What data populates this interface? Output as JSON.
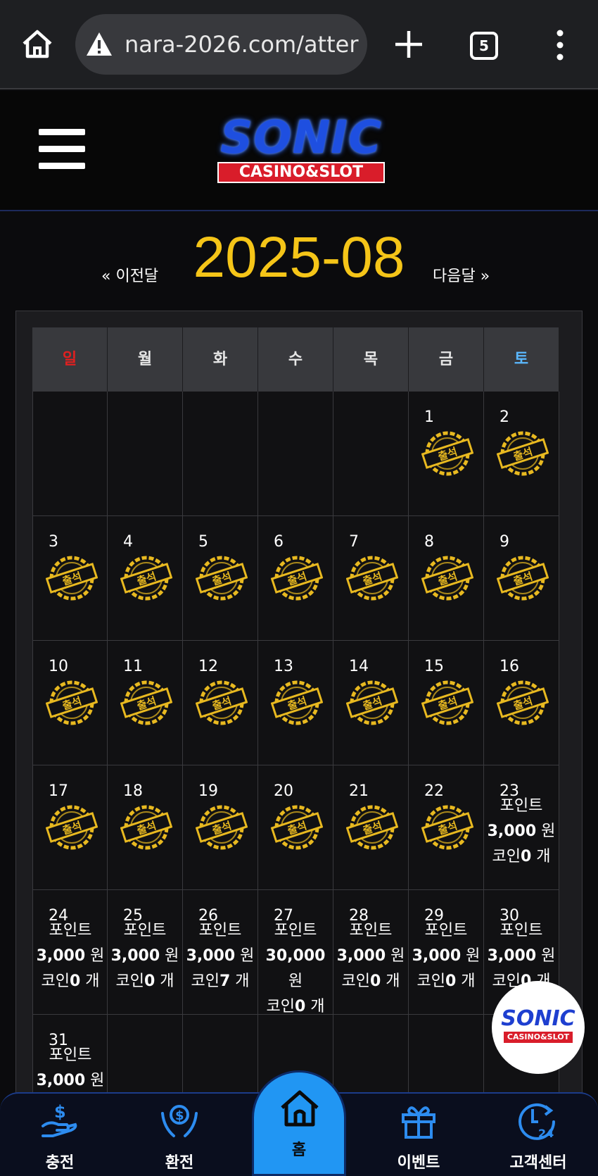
{
  "browser": {
    "url": "nara-2026.com/atter",
    "tab_count": "5"
  },
  "site": {
    "logo_main": "SONIC",
    "logo_sub": "CASINO&SLOT"
  },
  "calendar": {
    "prev_label": "« 이전달",
    "month": "2025-08",
    "next_label": "다음달 »",
    "weekdays": [
      "일",
      "월",
      "화",
      "수",
      "목",
      "금",
      "토"
    ],
    "stamp_label": "출석",
    "weeks": [
      [
        {
          "day": ""
        },
        {
          "day": ""
        },
        {
          "day": ""
        },
        {
          "day": ""
        },
        {
          "day": ""
        },
        {
          "day": "1",
          "stamp": true
        },
        {
          "day": "2",
          "stamp": true
        }
      ],
      [
        {
          "day": "3",
          "stamp": true
        },
        {
          "day": "4",
          "stamp": true
        },
        {
          "day": "5",
          "stamp": true
        },
        {
          "day": "6",
          "stamp": true
        },
        {
          "day": "7",
          "stamp": true
        },
        {
          "day": "8",
          "stamp": true
        },
        {
          "day": "9",
          "stamp": true
        }
      ],
      [
        {
          "day": "10",
          "stamp": true
        },
        {
          "day": "11",
          "stamp": true
        },
        {
          "day": "12",
          "stamp": true
        },
        {
          "day": "13",
          "stamp": true
        },
        {
          "day": "14",
          "stamp": true
        },
        {
          "day": "15",
          "stamp": true
        },
        {
          "day": "16",
          "stamp": true
        }
      ],
      [
        {
          "day": "17",
          "stamp": true
        },
        {
          "day": "18",
          "stamp": true
        },
        {
          "day": "19",
          "stamp": true
        },
        {
          "day": "20",
          "stamp": true
        },
        {
          "day": "21",
          "stamp": true
        },
        {
          "day": "22",
          "stamp": true
        },
        {
          "day": "23",
          "point_label": "포인트",
          "points": "3,000",
          "point_unit": "원",
          "coin_label": "코인",
          "coins": "0",
          "coin_unit": "개"
        }
      ],
      [
        {
          "day": "24",
          "point_label": "포인트",
          "points": "3,000",
          "point_unit": "원",
          "coin_label": "코인",
          "coins": "0",
          "coin_unit": "개"
        },
        {
          "day": "25",
          "point_label": "포인트",
          "points": "3,000",
          "point_unit": "원",
          "coin_label": "코인",
          "coins": "0",
          "coin_unit": "개"
        },
        {
          "day": "26",
          "point_label": "포인트",
          "points": "3,000",
          "point_unit": "원",
          "coin_label": "코인",
          "coins": "7",
          "coin_unit": "개"
        },
        {
          "day": "27",
          "point_label": "포인트",
          "points": "30,000",
          "point_unit": "원",
          "coin_label": "코인",
          "coins": "0",
          "coin_unit": "개"
        },
        {
          "day": "28",
          "point_label": "포인트",
          "points": "3,000",
          "point_unit": "원",
          "coin_label": "코인",
          "coins": "0",
          "coin_unit": "개"
        },
        {
          "day": "29",
          "point_label": "포인트",
          "points": "3,000",
          "point_unit": "원",
          "coin_label": "코인",
          "coins": "0",
          "coin_unit": "개"
        },
        {
          "day": "30",
          "point_label": "포인트",
          "points": "3,000",
          "point_unit": "원",
          "coin_label": "코인",
          "coins": "0",
          "coin_unit": "개"
        }
      ],
      [
        {
          "day": "31",
          "point_label": "포인트",
          "points": "3,000",
          "point_unit": "원"
        },
        {
          "day": ""
        },
        {
          "day": ""
        },
        {
          "day": ""
        },
        {
          "day": ""
        },
        {
          "day": ""
        },
        {
          "day": ""
        }
      ]
    ]
  },
  "float_logo": {
    "main": "SONIC",
    "sub": "CASINO&SLOT"
  },
  "bottom_nav": {
    "deposit": "충전",
    "withdraw": "환전",
    "home": "홈",
    "event": "이벤트",
    "support": "고객센터",
    "support_badge": "24"
  },
  "colors": {
    "month_title": "#f5c518",
    "stamp_gold": "#e8b920",
    "sunday": "#e02020",
    "saturday": "#5bb8ff",
    "nav_blue": "#2196f3"
  }
}
